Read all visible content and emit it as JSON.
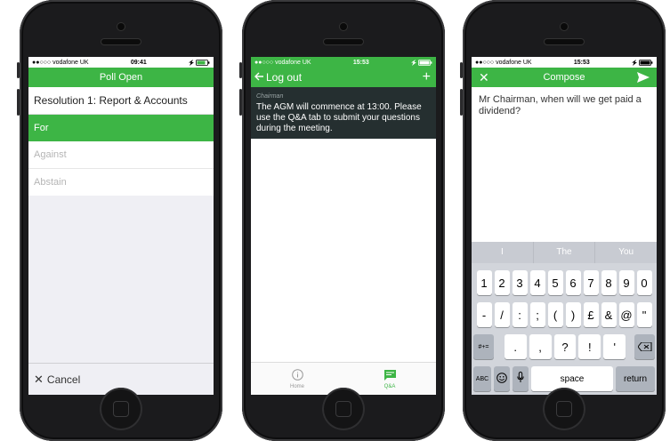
{
  "phone1": {
    "status": {
      "carrier": "●●○○○ vodafone UK",
      "time": "09:41",
      "signal": "⌯ ▭"
    },
    "nav_title": "Poll Open",
    "resolution": "Resolution 1: Report & Accounts",
    "options": [
      "For",
      "Against",
      "Abstain"
    ],
    "cancel_label": "Cancel"
  },
  "phone2": {
    "status": {
      "carrier": "●●○○○ vodafone UK",
      "time": "15:53"
    },
    "nav_back": "Log out",
    "nav_add": "+",
    "message": {
      "author": "Chairman",
      "text": "The AGM will commence at 13:00. Please use the Q&A tab to submit your questions during the meeting."
    },
    "tabs": [
      {
        "label": "Home",
        "icon": "info-icon"
      },
      {
        "label": "Q&A",
        "icon": "chat-icon"
      }
    ]
  },
  "phone3": {
    "status": {
      "carrier": "●●○○○ vodafone UK",
      "time": "15:53"
    },
    "nav_title": "Compose",
    "compose_text": "Mr Chairman, when will we get paid a dividend?",
    "suggestions": [
      "I",
      "The",
      "You"
    ],
    "row1": [
      "1",
      "2",
      "3",
      "4",
      "5",
      "6",
      "7",
      "8",
      "9",
      "0"
    ],
    "row2": [
      "-",
      "/",
      ":",
      ";",
      "(",
      ")",
      "£",
      "&",
      "@",
      "\""
    ],
    "row3": {
      "shift": "#+=",
      "keys": [
        ".",
        ",",
        "?",
        "!",
        "'"
      ]
    },
    "row4": {
      "abc": "ABC",
      "space": "space",
      "return": "return"
    }
  },
  "colors": {
    "accent": "#3db545",
    "message_bg": "#252f30"
  }
}
